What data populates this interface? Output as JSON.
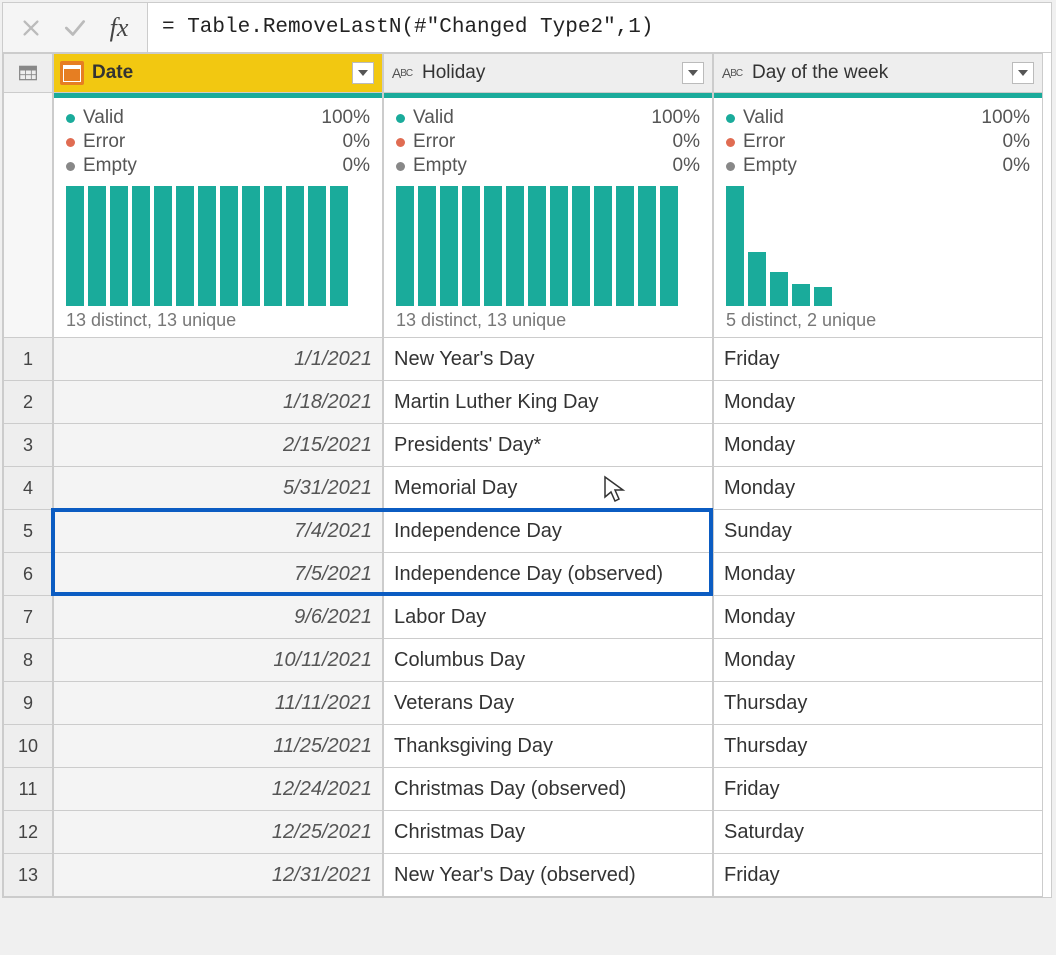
{
  "formula": "= Table.RemoveLastN(#\"Changed Type2\",1)",
  "columns": [
    {
      "name": "Date",
      "type": "date",
      "selected": true,
      "stats": {
        "valid": "100%",
        "error": "0%",
        "empty": "0%",
        "distinct": "13 distinct, 13 unique"
      },
      "bars": [
        100,
        100,
        100,
        100,
        100,
        100,
        100,
        100,
        100,
        100,
        100,
        100,
        100
      ]
    },
    {
      "name": "Holiday",
      "type": "text",
      "selected": false,
      "stats": {
        "valid": "100%",
        "error": "0%",
        "empty": "0%",
        "distinct": "13 distinct, 13 unique"
      },
      "bars": [
        100,
        100,
        100,
        100,
        100,
        100,
        100,
        100,
        100,
        100,
        100,
        100,
        100
      ]
    },
    {
      "name": "Day of the week",
      "type": "text",
      "selected": false,
      "stats": {
        "valid": "100%",
        "error": "0%",
        "empty": "0%",
        "distinct": "5 distinct, 2 unique"
      },
      "bars": [
        100,
        45,
        28,
        18,
        16
      ]
    }
  ],
  "labels": {
    "valid": "Valid",
    "error": "Error",
    "empty": "Empty"
  },
  "rows": [
    {
      "n": "1",
      "date": "1/1/2021",
      "holiday": "New Year's Day",
      "dow": "Friday"
    },
    {
      "n": "2",
      "date": "1/18/2021",
      "holiday": "Martin Luther King Day",
      "dow": "Monday"
    },
    {
      "n": "3",
      "date": "2/15/2021",
      "holiday": "Presidents' Day*",
      "dow": "Monday"
    },
    {
      "n": "4",
      "date": "5/31/2021",
      "holiday": "Memorial Day",
      "dow": "Monday"
    },
    {
      "n": "5",
      "date": "7/4/2021",
      "holiday": "Independence Day",
      "dow": "Sunday"
    },
    {
      "n": "6",
      "date": "7/5/2021",
      "holiday": "Independence Day (observed)",
      "dow": "Monday"
    },
    {
      "n": "7",
      "date": "9/6/2021",
      "holiday": "Labor Day",
      "dow": "Monday"
    },
    {
      "n": "8",
      "date": "10/11/2021",
      "holiday": "Columbus Day",
      "dow": "Monday"
    },
    {
      "n": "9",
      "date": "11/11/2021",
      "holiday": "Veterans Day",
      "dow": "Thursday"
    },
    {
      "n": "10",
      "date": "11/25/2021",
      "holiday": "Thanksgiving Day",
      "dow": "Thursday"
    },
    {
      "n": "11",
      "date": "12/24/2021",
      "holiday": "Christmas Day (observed)",
      "dow": "Friday"
    },
    {
      "n": "12",
      "date": "12/25/2021",
      "holiday": "Christmas Day",
      "dow": "Saturday"
    },
    {
      "n": "13",
      "date": "12/31/2021",
      "holiday": "New Year's Day (observed)",
      "dow": "Friday"
    }
  ],
  "highlight": {
    "row_start": 5,
    "row_end": 6,
    "col_start": 1,
    "col_end": 2
  }
}
